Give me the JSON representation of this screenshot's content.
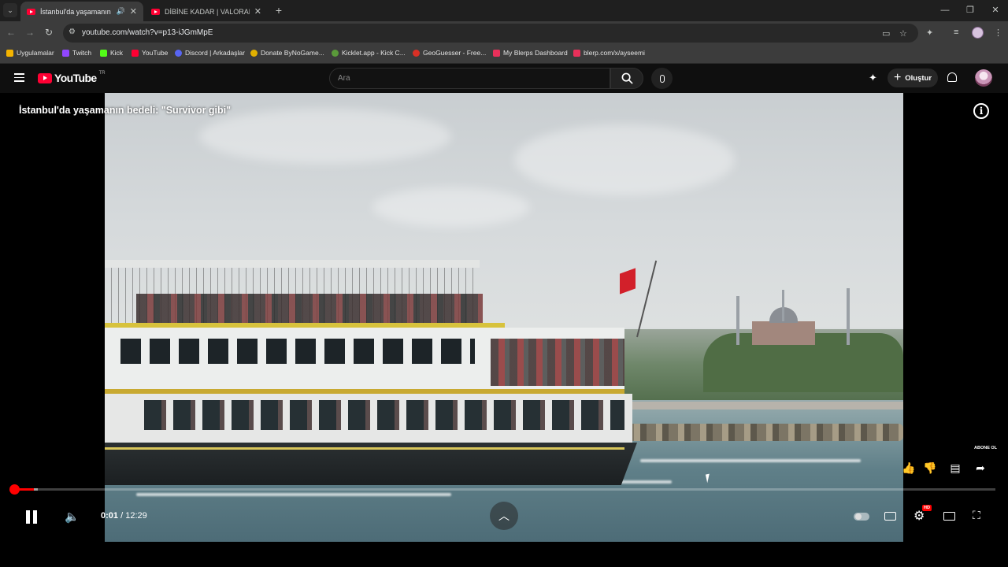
{
  "browser": {
    "tabs": [
      {
        "title": "İstanbul'da yaşamanın bede",
        "active": true,
        "audio": true
      },
      {
        "title": "DİBİNE KADAR | VALORANT ED",
        "active": false,
        "audio": false
      }
    ],
    "new_tab_label": "+",
    "url": "youtube.com/watch?v=p13-iJGmMpE",
    "bookmarks": [
      {
        "label": "Uygulamalar",
        "icon": "apps-grid-icon",
        "color": "#f4b400"
      },
      {
        "label": "Twitch",
        "icon": "twitch-icon",
        "color": "#9146ff"
      },
      {
        "label": "Kick",
        "icon": "kick-icon",
        "color": "#53fc18"
      },
      {
        "label": "YouTube",
        "icon": "youtube-icon",
        "color": "#ff0033"
      },
      {
        "label": "Discord | Arkadaşlar",
        "icon": "discord-icon",
        "color": "#5865f2"
      },
      {
        "label": "Donate ByNoGame...",
        "icon": "bynogame-icon",
        "color": "#e0b000"
      },
      {
        "label": "Kicklet.app - Kick C...",
        "icon": "kicklet-icon",
        "color": "#5a9a3a"
      },
      {
        "label": "GeoGuesser - Free...",
        "icon": "geoguesser-icon",
        "color": "#d93025"
      },
      {
        "label": "My Blerps Dashboard",
        "icon": "blerp-icon",
        "color": "#e8305a"
      },
      {
        "label": "blerp.com/x/ayseemi",
        "icon": "blerp-icon",
        "color": "#e8305a"
      }
    ]
  },
  "youtube": {
    "logo_text": "YouTube",
    "country_code": "TR",
    "search_placeholder": "Ara",
    "create_label": "Oluştur",
    "accent": "#ff0033"
  },
  "player": {
    "title": "İstanbul'da yaşamanın bedeli: \"Survivor gibi\"",
    "subscribe_label": "ABONE OL",
    "current_time": "0:01",
    "separator": " / ",
    "duration": "12:29",
    "progress_fraction": 0.0013,
    "hd_badge": "HD",
    "state": "playing"
  }
}
